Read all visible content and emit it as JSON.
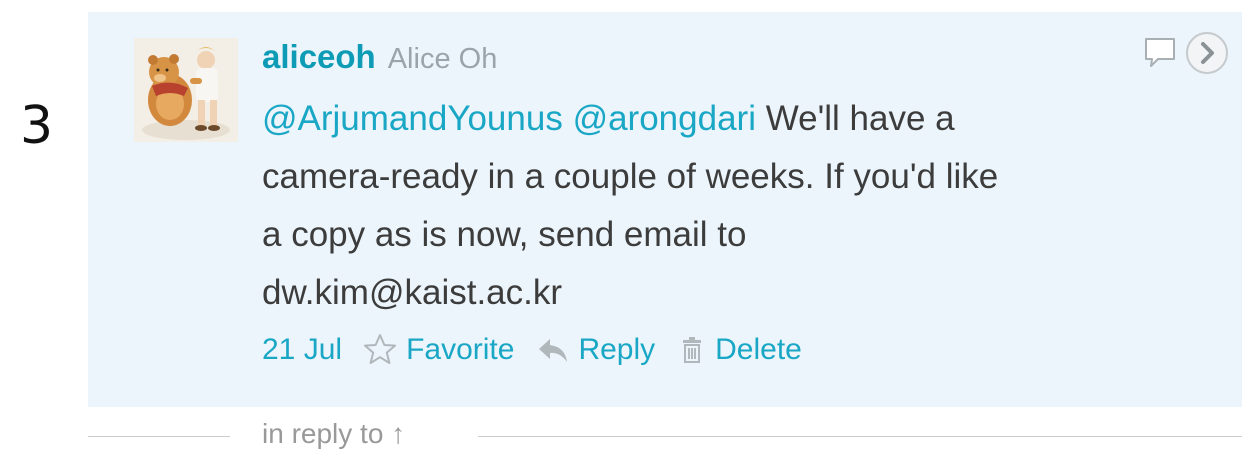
{
  "row_number": "3",
  "tweet": {
    "username": "aliceoh",
    "full_name": "Alice Oh",
    "mention_1": "@ArjumandYounus",
    "mention_2": "@arongdari",
    "text_part_1": " We'll have a ",
    "text_part_2": "camera-ready in a couple of weeks. If you'd like ",
    "text_part_3": "a copy as is now, send email to ",
    "text_part_4": "dw.kim@kaist.ac.kr",
    "timestamp": "21 Jul",
    "actions": {
      "favorite": "Favorite",
      "reply": "Reply",
      "delete": "Delete"
    }
  },
  "reply_context": {
    "label": "in reply to ↑"
  },
  "colors": {
    "tweet_background": "#ebf5fb",
    "link": "#1aa7c6",
    "username": "#0e9bb5",
    "body_text": "#3c3c3c",
    "muted": "#9aa4aa"
  },
  "icons": {
    "avatar": "winnie-the-pooh-avatar",
    "favorite": "star-outline-icon",
    "reply": "reply-arrow-icon",
    "delete": "trash-icon",
    "speech": "speech-bubble-icon",
    "expand": "chevron-right-circle-icon"
  }
}
